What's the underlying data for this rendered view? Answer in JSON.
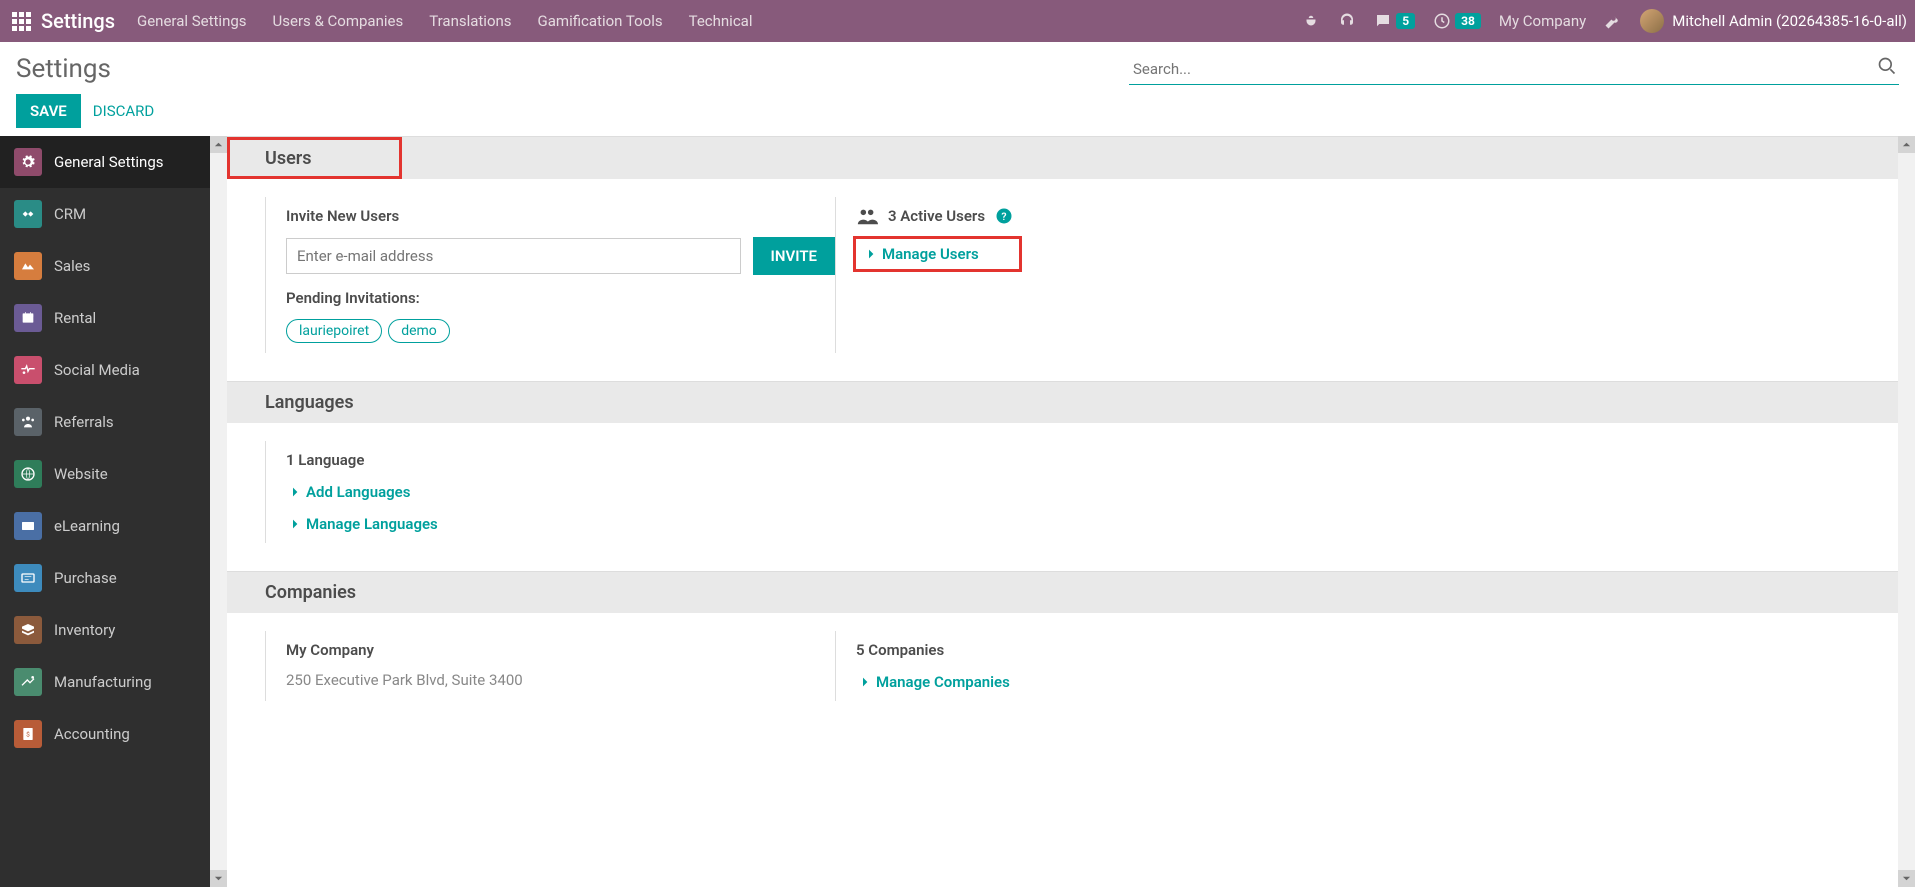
{
  "topbar": {
    "brand": "Settings",
    "nav": [
      "General Settings",
      "Users & Companies",
      "Translations",
      "Gamification Tools",
      "Technical"
    ],
    "msg_badge": "5",
    "clock_badge": "38",
    "company": "My Company",
    "user": "Mitchell Admin (20264385-16-0-all)"
  },
  "cp": {
    "title": "Settings",
    "save": "SAVE",
    "discard": "DISCARD",
    "search_ph": "Search..."
  },
  "sidebar": [
    {
      "label": "General Settings",
      "color": "#8f4b6b",
      "active": true
    },
    {
      "label": "CRM",
      "color": "#2a8c86"
    },
    {
      "label": "Sales",
      "color": "#d67d3e"
    },
    {
      "label": "Rental",
      "color": "#6b5b95"
    },
    {
      "label": "Social Media",
      "color": "#c94f6d"
    },
    {
      "label": "Referrals",
      "color": "#5a6268"
    },
    {
      "label": "Website",
      "color": "#2f7d5a"
    },
    {
      "label": "eLearning",
      "color": "#4a6fa5"
    },
    {
      "label": "Purchase",
      "color": "#3d8bbd"
    },
    {
      "label": "Inventory",
      "color": "#8b5a3c"
    },
    {
      "label": "Manufacturing",
      "color": "#4a8c6f"
    },
    {
      "label": "Accounting",
      "color": "#b85c38"
    }
  ],
  "users": {
    "head": "Users",
    "invite_lbl": "Invite New Users",
    "invite_ph": "Enter e-mail address",
    "invite_btn": "INVITE",
    "pending_lbl": "Pending Invitations:",
    "tags": [
      "lauriepoiret",
      "demo"
    ],
    "active": "3 Active Users",
    "manage": "Manage Users"
  },
  "languages": {
    "head": "Languages",
    "count": "1 Language",
    "add": "Add Languages",
    "manage": "Manage Languages"
  },
  "companies": {
    "head": "Companies",
    "name": "My Company",
    "addr": "250 Executive Park Blvd, Suite 3400",
    "count": "5 Companies",
    "manage": "Manage Companies"
  }
}
